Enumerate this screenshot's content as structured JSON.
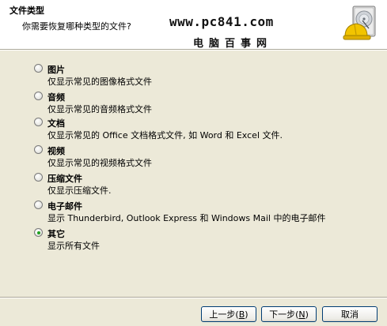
{
  "header": {
    "title": "文件类型",
    "subtitle": "你需要恢复哪种类型的文件?"
  },
  "watermark": {
    "url": "www.pc841.com",
    "name": "电脑百事网"
  },
  "options": [
    {
      "label": "图片",
      "description": "仅显示常见的图像格式文件",
      "checked": false
    },
    {
      "label": "音频",
      "description": "仅显示常见的音频格式文件",
      "checked": false
    },
    {
      "label": "文档",
      "description": "仅显示常见的 Office 文档格式文件, 如 Word 和 Excel 文件.",
      "checked": false
    },
    {
      "label": "视频",
      "description": "仅显示常见的视频格式文件",
      "checked": false
    },
    {
      "label": "压缩文件",
      "description": "仅显示压缩文件.",
      "checked": false
    },
    {
      "label": "电子邮件",
      "description": "显示 Thunderbird, Outlook Express 和 Windows Mail 中的电子邮件",
      "checked": false
    },
    {
      "label": "其它",
      "description": "显示所有文件",
      "checked": true
    }
  ],
  "buttons": {
    "back": {
      "text": "上一步",
      "accel": "B"
    },
    "next": {
      "text": "下一步",
      "accel": "N"
    },
    "cancel": "取消"
  },
  "icons": {
    "wizard": "hard-drive-hardhat-icon"
  },
  "colors": {
    "radio_selected": "#21a121",
    "button_border": "#003c74",
    "dialog_bg": "#ece9d8"
  }
}
